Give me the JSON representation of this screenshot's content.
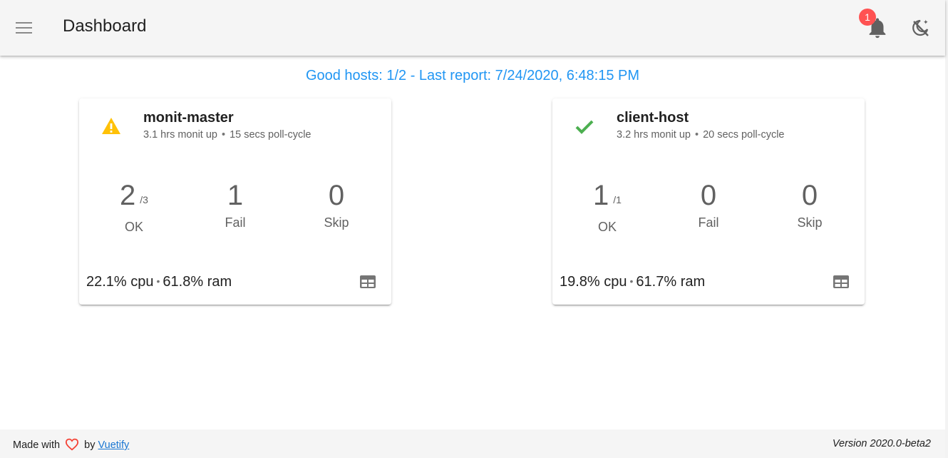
{
  "app": {
    "title": "Dashboard",
    "notification_count": "1"
  },
  "summary": "Good hosts: 1/2 - Last report: 7/24/2020, 6:48:15 PM",
  "hosts": [
    {
      "name": "monit-master",
      "status_icon": "warning-icon",
      "status_color": "#ffc107",
      "uptime": "3.1 hrs monit up",
      "poll_cycle": "15 secs poll-cycle",
      "ok": "2",
      "ok_total": "/3",
      "fail": "1",
      "skip": "0",
      "ok_label": "OK",
      "fail_label": "Fail",
      "skip_label": "Skip",
      "cpu": "22.1% cpu",
      "ram": "61.8% ram"
    },
    {
      "name": "client-host",
      "status_icon": "check-icon",
      "status_color": "#4caf50",
      "uptime": "3.2 hrs monit up",
      "poll_cycle": "20 secs poll-cycle",
      "ok": "1",
      "ok_total": "/1",
      "fail": "0",
      "skip": "0",
      "ok_label": "OK",
      "fail_label": "Fail",
      "skip_label": "Skip",
      "cpu": "19.8% cpu",
      "ram": "61.7% ram"
    }
  ],
  "footer": {
    "made_with": "Made with",
    "by": "by",
    "link": "Vuetify",
    "version": "Version 2020.0-beta2"
  },
  "colors": {
    "accent": "#2196f3",
    "badge": "#ff5252",
    "heart": "#f44336"
  }
}
